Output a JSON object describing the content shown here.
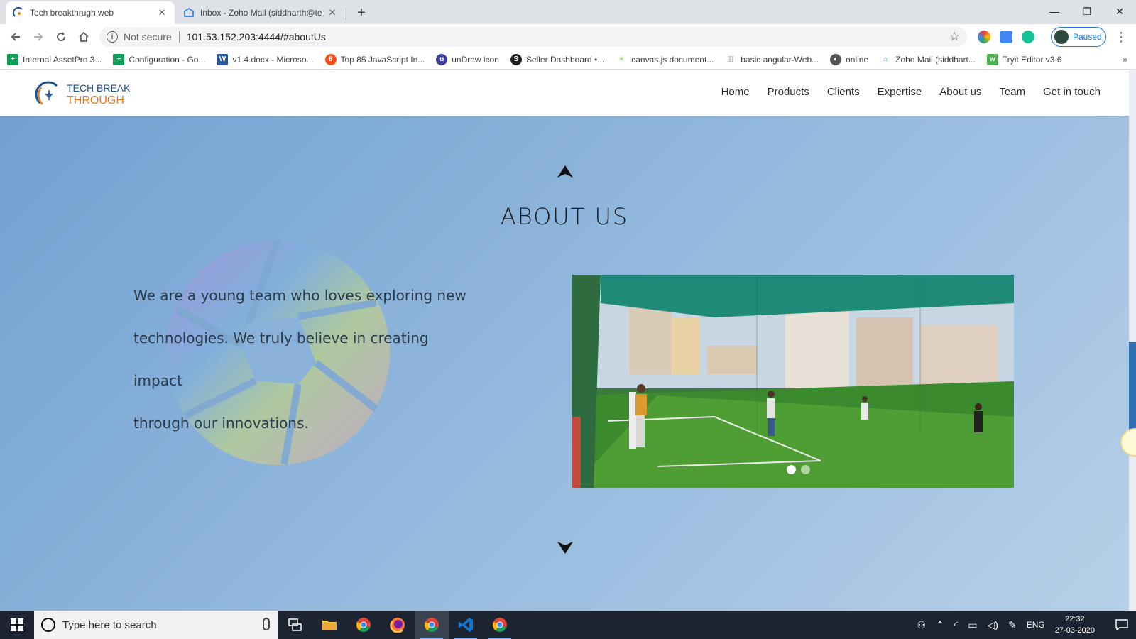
{
  "browser": {
    "tabs": [
      {
        "title": "Tech breakthrugh web",
        "active": true
      },
      {
        "title": "Inbox - Zoho Mail (siddharth@te",
        "active": false
      }
    ],
    "new_tab": "+",
    "window_controls": {
      "minimize": "—",
      "restore": "❐",
      "close": "✕"
    },
    "toolbar": {
      "not_secure": "Not secure",
      "url": "101.53.152.203:4444/#aboutUs",
      "profile_status": "Paused"
    },
    "bookmarks": [
      {
        "label": "Internal AssetPro 3...",
        "icon": "sheets-icon",
        "color": "#0f9d58"
      },
      {
        "label": "Configuration - Go...",
        "icon": "sheets-icon",
        "color": "#0f9d58"
      },
      {
        "label": "v1.4.docx - Microso...",
        "icon": "word-icon",
        "color": "#2b579a"
      },
      {
        "label": "Top 85 JavaScript In...",
        "icon": "orange-dot-icon",
        "color": "#f4511e"
      },
      {
        "label": "unDraw icon",
        "icon": "undraw-icon",
        "color": "#3f3d9a"
      },
      {
        "label": "Seller Dashboard •...",
        "icon": "seller-icon",
        "color": "#222222"
      },
      {
        "label": "canvas.js document...",
        "icon": "canvasjs-icon",
        "color": "#8bc34a"
      },
      {
        "label": "basic angular-Web...",
        "icon": "bars-icon",
        "color": "#9e9e9e"
      },
      {
        "label": "online",
        "icon": "globe-icon",
        "color": "#555555"
      },
      {
        "label": "Zoho Mail (siddhart...",
        "icon": "zoho-mail-icon",
        "color": "#1a73e8"
      },
      {
        "label": "Tryit Editor v3.6",
        "icon": "w3-icon",
        "color": "#4caf50"
      }
    ],
    "bookmarks_more": "»"
  },
  "site": {
    "logo": {
      "line1": "TECH BREAK",
      "line2": "THROUGH"
    },
    "nav": [
      "Home",
      "Products",
      "Clients",
      "Expertise",
      "About us",
      "Team",
      "Get in touch"
    ],
    "about": {
      "title": "ABOUT US",
      "lines": [
        "We are a young team who loves exploring new",
        "technologies. We truly believe in creating impact",
        "through our innovations."
      ]
    },
    "carousel": {
      "slide_count": 2,
      "active_index": 0
    }
  },
  "taskbar": {
    "search_placeholder": "Type here to search",
    "apps": [
      "task-view-icon",
      "file-explorer-icon",
      "chrome-icon",
      "firefox-icon",
      "chrome-dev-icon",
      "vscode-icon",
      "chrome-canary-icon"
    ],
    "language": "ENG",
    "time": "22:32",
    "date": "27-03-2020"
  },
  "colors": {
    "accent_blue": "#1f4f8f",
    "accent_orange": "#e47b1f",
    "page_gradient_start": "#6f9fd0",
    "page_gradient_end": "#b7d0e8"
  }
}
